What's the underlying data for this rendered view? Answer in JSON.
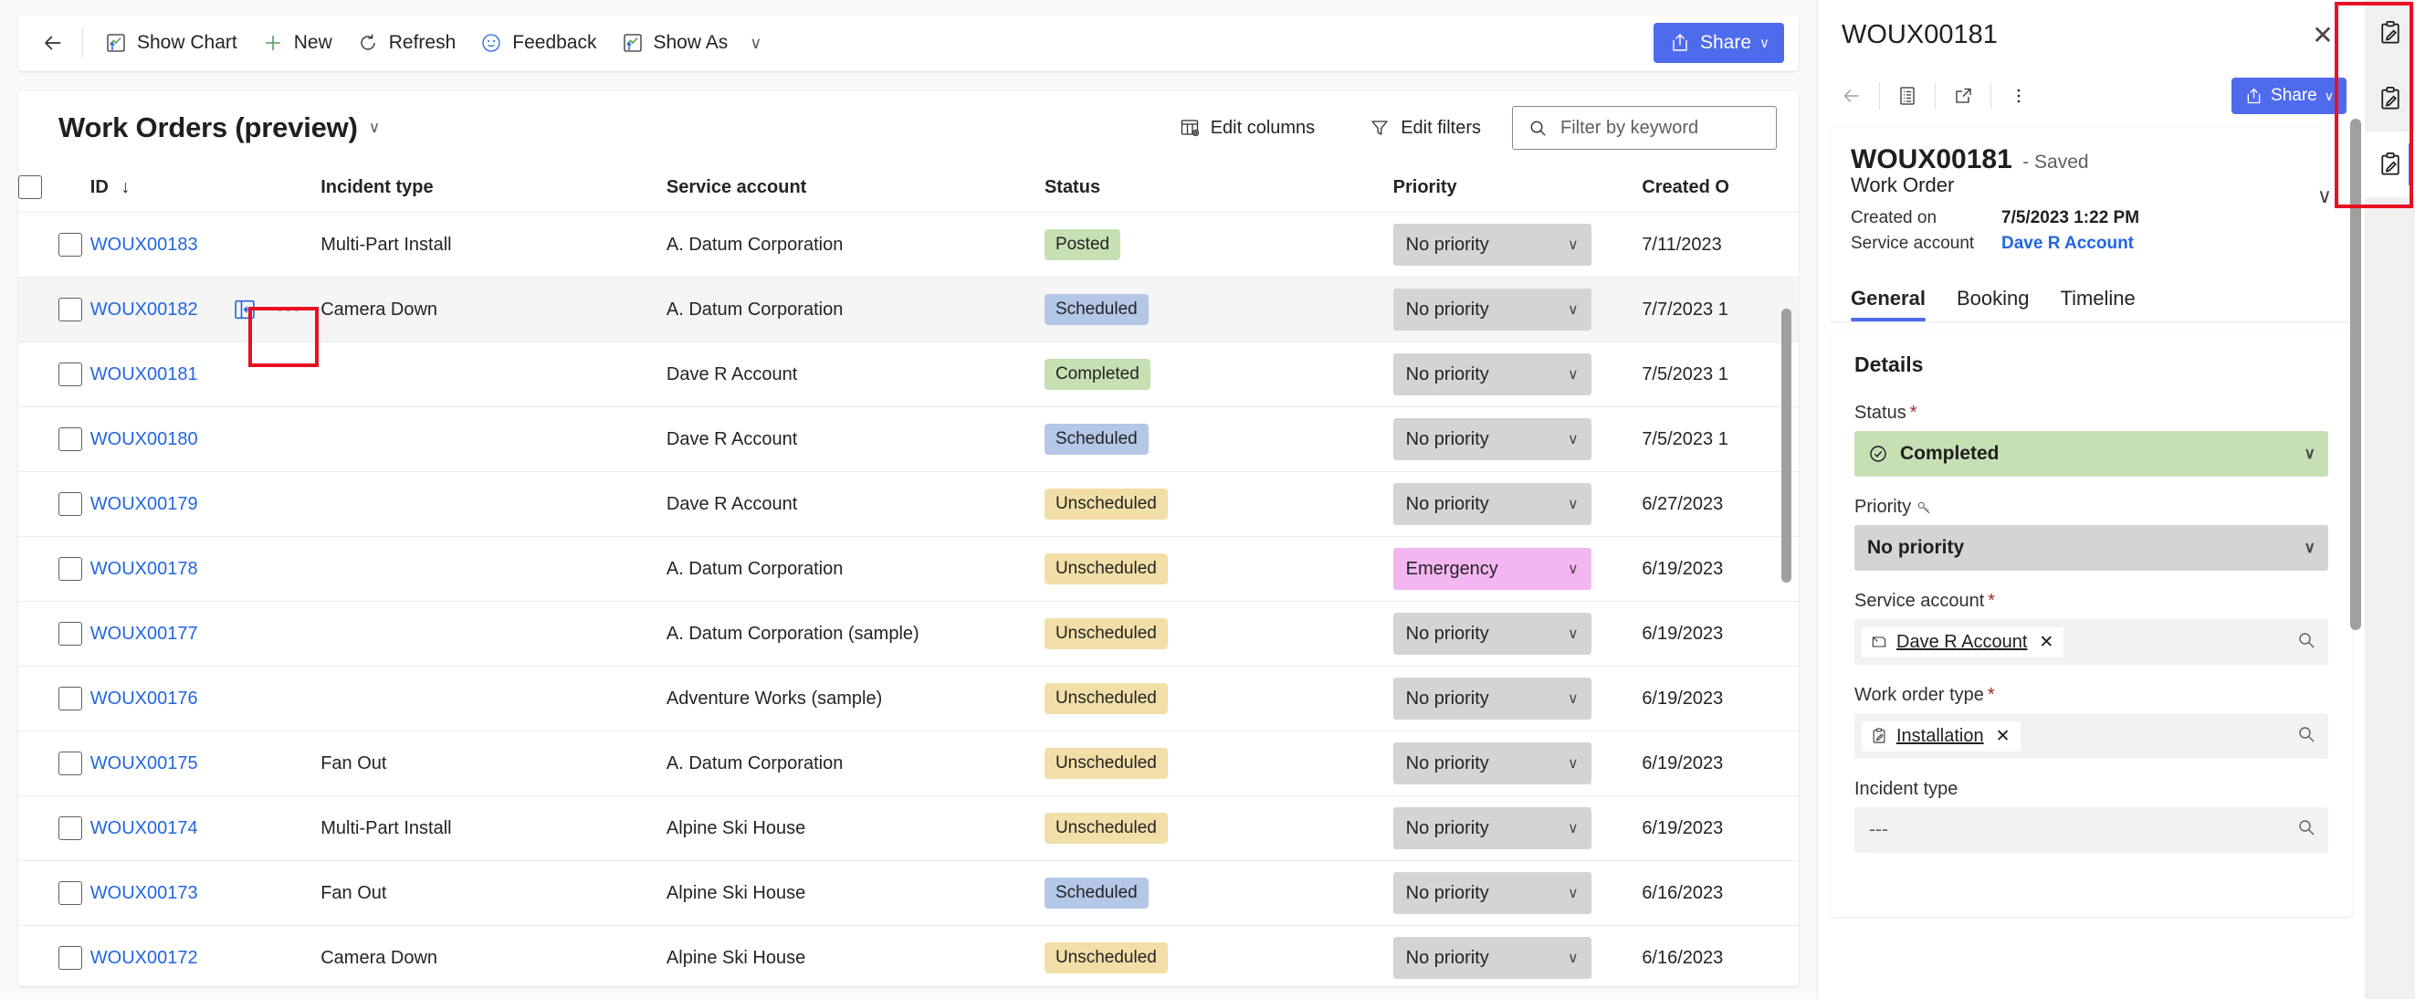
{
  "commandbar": {
    "back_label": "Back",
    "buttons": [
      {
        "label": "Show Chart",
        "icon": "chart-icon"
      },
      {
        "label": "New",
        "icon": "plus-icon"
      },
      {
        "label": "Refresh",
        "icon": "refresh-icon"
      },
      {
        "label": "Feedback",
        "icon": "smiley-icon"
      },
      {
        "label": "Show As",
        "icon": "chart-icon"
      }
    ],
    "show_as_chevron": "∨",
    "share_label": "Share",
    "share_chevron": "∨",
    "share_color": "#4f6bed"
  },
  "grid": {
    "view_title": "Work Orders (preview)",
    "view_chevron": "∨",
    "edit_columns_label": "Edit columns",
    "edit_filters_label": "Edit filters",
    "search_placeholder": "Filter by keyword",
    "search_value": "",
    "columns": [
      {
        "key": "id",
        "label": "ID",
        "sort": "↓"
      },
      {
        "key": "inc",
        "label": "Incident type"
      },
      {
        "key": "svc",
        "label": "Service account"
      },
      {
        "key": "status",
        "label": "Status"
      },
      {
        "key": "pri",
        "label": "Priority"
      },
      {
        "key": "created",
        "label": "Created O"
      }
    ],
    "rows": [
      {
        "id": "WOUX00183",
        "incident": "Multi-Part Install",
        "service": "A. Datum Corporation",
        "status": "Posted",
        "status_color": "green",
        "priority": "No priority",
        "priority_color": "grey",
        "created": "7/11/2023",
        "selected": false
      },
      {
        "id": "WOUX00182",
        "incident": "Camera Down",
        "service": "A. Datum Corporation",
        "status": "Scheduled",
        "status_color": "blue",
        "priority": "No priority",
        "priority_color": "grey",
        "created": "7/7/2023 1",
        "selected": true
      },
      {
        "id": "WOUX00181",
        "incident": "",
        "service": "Dave R Account",
        "status": "Completed",
        "status_color": "green",
        "priority": "No priority",
        "priority_color": "grey",
        "created": "7/5/2023 1",
        "selected": false
      },
      {
        "id": "WOUX00180",
        "incident": "",
        "service": "Dave R Account",
        "status": "Scheduled",
        "status_color": "blue",
        "priority": "No priority",
        "priority_color": "grey",
        "created": "7/5/2023 1",
        "selected": false
      },
      {
        "id": "WOUX00179",
        "incident": "",
        "service": "Dave R Account",
        "status": "Unscheduled",
        "status_color": "yellow",
        "priority": "No priority",
        "priority_color": "grey",
        "created": "6/27/2023",
        "selected": false
      },
      {
        "id": "WOUX00178",
        "incident": "",
        "service": "A. Datum Corporation",
        "status": "Unscheduled",
        "status_color": "yellow",
        "priority": "Emergency",
        "priority_color": "pink",
        "created": "6/19/2023",
        "selected": false
      },
      {
        "id": "WOUX00177",
        "incident": "",
        "service": "A. Datum Corporation (sample)",
        "status": "Unscheduled",
        "status_color": "yellow",
        "priority": "No priority",
        "priority_color": "grey",
        "created": "6/19/2023",
        "selected": false
      },
      {
        "id": "WOUX00176",
        "incident": "",
        "service": "Adventure Works (sample)",
        "status": "Unscheduled",
        "status_color": "yellow",
        "priority": "No priority",
        "priority_color": "grey",
        "created": "6/19/2023",
        "selected": false
      },
      {
        "id": "WOUX00175",
        "incident": "Fan Out",
        "service": "A. Datum Corporation",
        "status": "Unscheduled",
        "status_color": "yellow",
        "priority": "No priority",
        "priority_color": "grey",
        "created": "6/19/2023",
        "selected": false
      },
      {
        "id": "WOUX00174",
        "incident": "Multi-Part Install",
        "service": "Alpine Ski House",
        "status": "Unscheduled",
        "status_color": "yellow",
        "priority": "No priority",
        "priority_color": "grey",
        "created": "6/19/2023",
        "selected": false
      },
      {
        "id": "WOUX00173",
        "incident": "Fan Out",
        "service": "Alpine Ski House",
        "status": "Scheduled",
        "status_color": "blue",
        "priority": "No priority",
        "priority_color": "grey",
        "created": "6/16/2023",
        "selected": false
      },
      {
        "id": "WOUX00172",
        "incident": "Camera Down",
        "service": "Alpine Ski House",
        "status": "Unscheduled",
        "status_color": "yellow",
        "priority": "No priority",
        "priority_color": "grey",
        "created": "6/16/2023",
        "selected": false
      }
    ],
    "row_command_ellipsis": "···",
    "priority_chevron": "∨"
  },
  "side_panel": {
    "header_title": "WOUX00181",
    "close_label": "✕",
    "toolbar": {
      "back_icon": "back-arrow-icon",
      "form_icon": "form-icon",
      "popout_icon": "pop-out-icon",
      "more_icon": "more-vertical-icon",
      "share_label": "Share",
      "share_chevron": "∨"
    },
    "record": {
      "title": "WOUX00181",
      "saved_text": "- Saved",
      "entity": "Work Order",
      "fields": [
        {
          "label": "Created on",
          "value": "7/5/2023 1:22 PM",
          "link": false
        },
        {
          "label": "Service account",
          "value": "Dave R Account",
          "link": true
        }
      ],
      "expand_chevron": "∨"
    },
    "tabs": [
      {
        "label": "General",
        "active": true
      },
      {
        "label": "Booking",
        "active": false
      },
      {
        "label": "Timeline",
        "active": false
      }
    ],
    "details": {
      "section_title": "Details",
      "status": {
        "label": "Status",
        "required": "*",
        "value": "Completed",
        "chevron": "∨",
        "bg": "#c6e0b4",
        "icon": "check-circle-icon"
      },
      "priority": {
        "label": "Priority",
        "key_icon": "key-icon",
        "value": "No priority",
        "chevron": "∨",
        "bg": "#d2d4d6"
      },
      "service_account": {
        "label": "Service account",
        "required": "*",
        "tag_text": "Dave R Account",
        "tag_icon": "account-icon",
        "remove": "✕",
        "search_icon": "magnifier-icon"
      },
      "work_order_type": {
        "label": "Work order type",
        "required": "*",
        "tag_text": "Installation",
        "tag_icon": "clipboard-icon",
        "remove": "✕",
        "search_icon": "magnifier-icon"
      },
      "incident_type": {
        "label": "Incident type",
        "required": "",
        "value": "---",
        "search_icon": "magnifier-icon"
      }
    }
  },
  "rail": {
    "items": [
      {
        "icon": "clipboard-pencil-icon",
        "active": false
      },
      {
        "icon": "clipboard-pencil-icon",
        "active": false
      },
      {
        "icon": "clipboard-pencil-icon",
        "active": true
      }
    ],
    "highlight_color": "#e81123"
  }
}
